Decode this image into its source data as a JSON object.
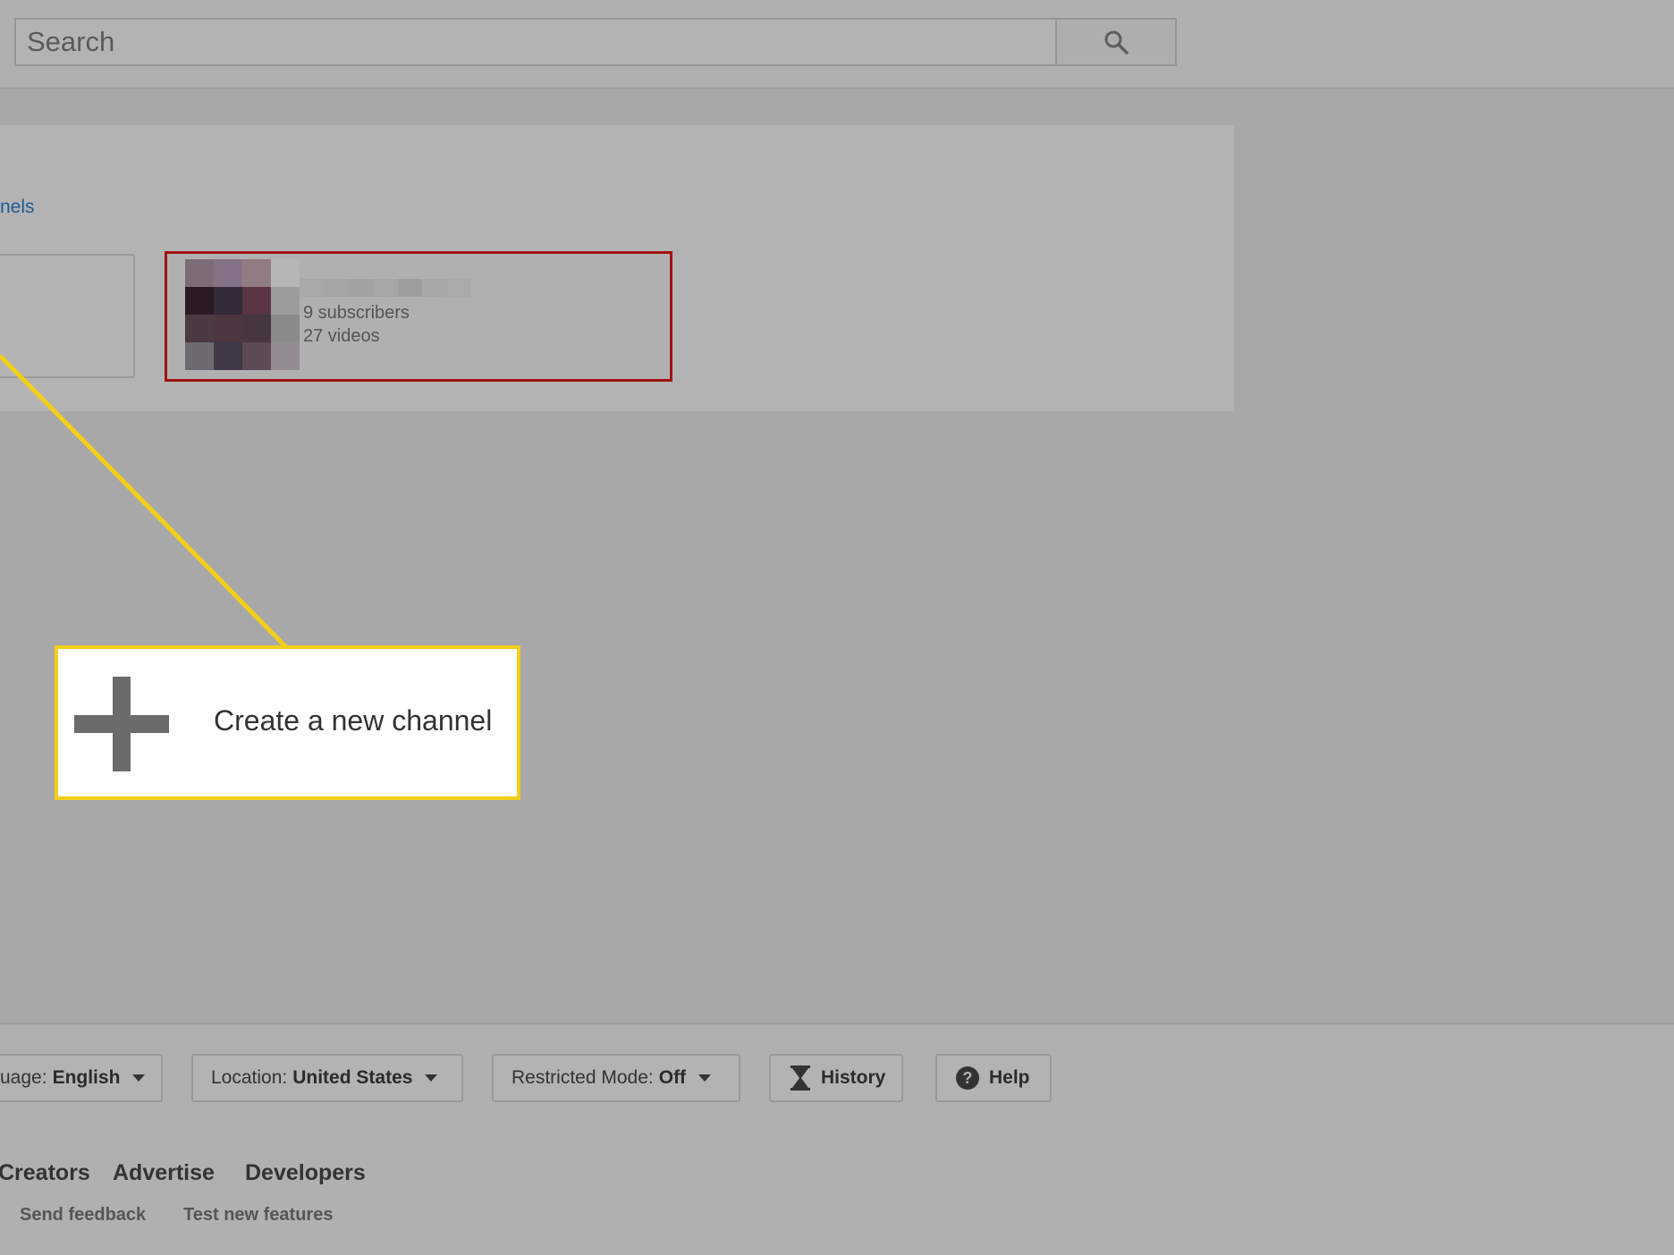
{
  "search": {
    "placeholder": "Search",
    "button_icon": "search-icon"
  },
  "page": {
    "all_channels_link": "nels"
  },
  "channel": {
    "subscribers": "9 subscribers",
    "videos": "27 videos"
  },
  "callout": {
    "label": "Create a new channel",
    "icon": "plus-icon"
  },
  "settings_bar": {
    "language_label": "uage:",
    "language_value": "English",
    "location_label": "Location:",
    "location_value": "United States",
    "restricted_label": "Restricted Mode:",
    "restricted_value": "Off",
    "history_label": "History",
    "help_label": "Help"
  },
  "footer": {
    "links": [
      "Creators",
      "Advertise",
      "Developers"
    ],
    "sub_links": [
      "Send feedback",
      "Test new features"
    ]
  },
  "colors": {
    "highlight_red": "#a01212",
    "callout_yellow": "#f3cf19",
    "link_blue": "#1c5c94"
  }
}
